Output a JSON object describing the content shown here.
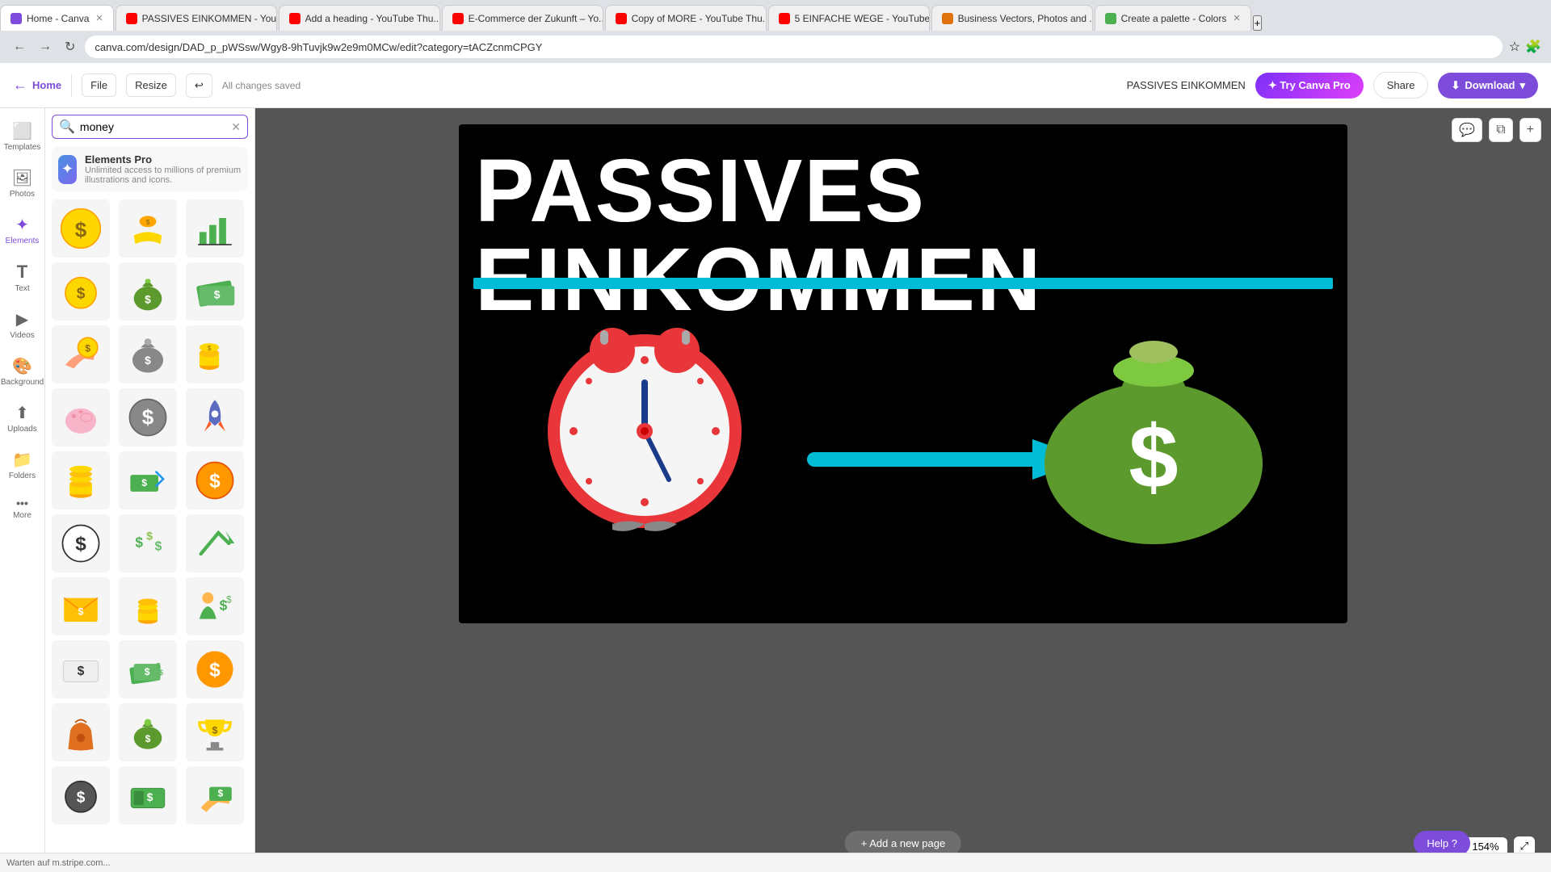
{
  "browser": {
    "tabs": [
      {
        "id": "t1",
        "label": "Home - Canva",
        "active": true,
        "icon_color": "#7d4cdb"
      },
      {
        "id": "t2",
        "label": "PASSIVES EINKOMMEN - You...",
        "active": false,
        "icon_color": "#ff0000"
      },
      {
        "id": "t3",
        "label": "Add a heading - YouTube Thu...",
        "active": false,
        "icon_color": "#ff0000"
      },
      {
        "id": "t4",
        "label": "E-Commerce der Zukunft – Yo...",
        "active": false,
        "icon_color": "#ff0000"
      },
      {
        "id": "t5",
        "label": "Copy of MORE - YouTube Thu...",
        "active": false,
        "icon_color": "#ff0000"
      },
      {
        "id": "t6",
        "label": "5 EINFACHE WEGE - YouTube ...",
        "active": false,
        "icon_color": "#ff0000"
      },
      {
        "id": "t7",
        "label": "Business Vectors, Photos and ...",
        "active": false,
        "icon_color": "#e0720c"
      },
      {
        "id": "t8",
        "label": "Create a palette - Colors",
        "active": false,
        "icon_color": "#4caf50"
      }
    ],
    "address": "canva.com/design/DAD_p_pWSsw/Wgy8-9hTuvjk9w2e9m0MCw/edit?category=tACZcnmCPGY"
  },
  "toolbar": {
    "home_label": "Home",
    "file_label": "File",
    "resize_label": "Resize",
    "saved_status": "All changes saved",
    "doc_title": "PASSIVES EINKOMMEN",
    "try_pro_label": "✦ Try Canva Pro",
    "share_label": "Share",
    "download_label": "Download",
    "undo_icon": "↩"
  },
  "sidebar": {
    "items": [
      {
        "id": "templates",
        "icon": "⬜",
        "label": "Templates"
      },
      {
        "id": "photos",
        "icon": "🖼",
        "label": "Photos"
      },
      {
        "id": "elements",
        "icon": "✦",
        "label": "Elements"
      },
      {
        "id": "text",
        "icon": "T",
        "label": "Text"
      },
      {
        "id": "videos",
        "icon": "▶",
        "label": "Videos"
      },
      {
        "id": "background",
        "icon": "🎨",
        "label": "Background"
      },
      {
        "id": "uploads",
        "icon": "⬆",
        "label": "Uploads"
      },
      {
        "id": "folders",
        "icon": "📁",
        "label": "Folders"
      },
      {
        "id": "more",
        "icon": "•••",
        "label": "More"
      }
    ]
  },
  "search_panel": {
    "search_value": "money",
    "elements_pro": {
      "title": "Elements Pro",
      "description": "Unlimited access to millions of premium illustrations and icons."
    }
  },
  "canvas": {
    "title_line1": "PASSIVES EINKOMMEN",
    "add_page_label": "+ Add a new page",
    "zoom_level": "154%",
    "help_label": "Help ?",
    "background_color": "#000000",
    "divider_color": "#00bcd4",
    "arrow_color": "#00bcd4"
  },
  "status_bar": {
    "text": "Warten auf m.stripe.com..."
  }
}
